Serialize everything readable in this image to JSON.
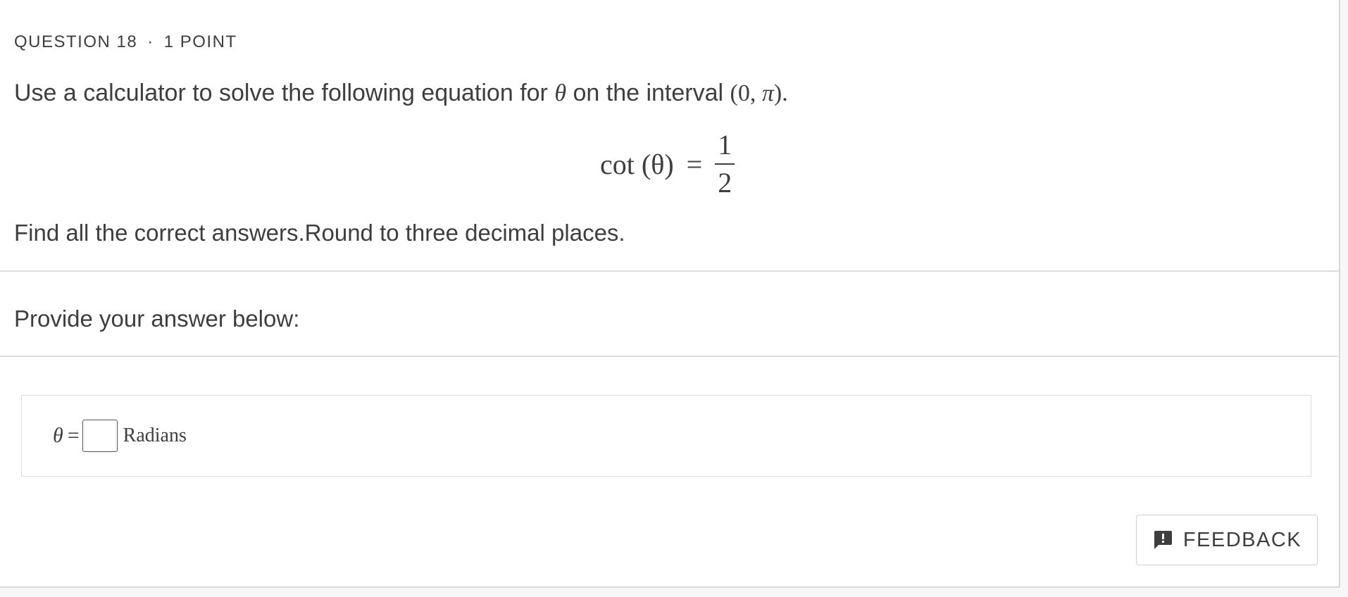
{
  "question": {
    "number_label": "QUESTION 18",
    "separator": "·",
    "points_label": "1 POINT",
    "prompt_prefix": "Use a calculator to solve the following equation for ",
    "prompt_var": "θ",
    "prompt_middle": " on the interval ",
    "prompt_interval_open": "(0, ",
    "prompt_interval_pi": "π",
    "prompt_interval_close": ").",
    "equation": {
      "lhs": "cot (θ)",
      "eq": "=",
      "numerator": "1",
      "denominator": "2"
    },
    "instructions": "Find all the correct answers.Round to three decimal places."
  },
  "answer_section": {
    "heading": "Provide your answer below:",
    "variable": "θ",
    "equals": "=",
    "input_value": "",
    "unit": "Radians"
  },
  "feedback": {
    "label": "FEEDBACK",
    "icon": "feedback-alert-icon"
  },
  "colors": {
    "text": "#3e3e3e",
    "divider": "#dcdcdc",
    "page_background": "#f7f7f7"
  }
}
